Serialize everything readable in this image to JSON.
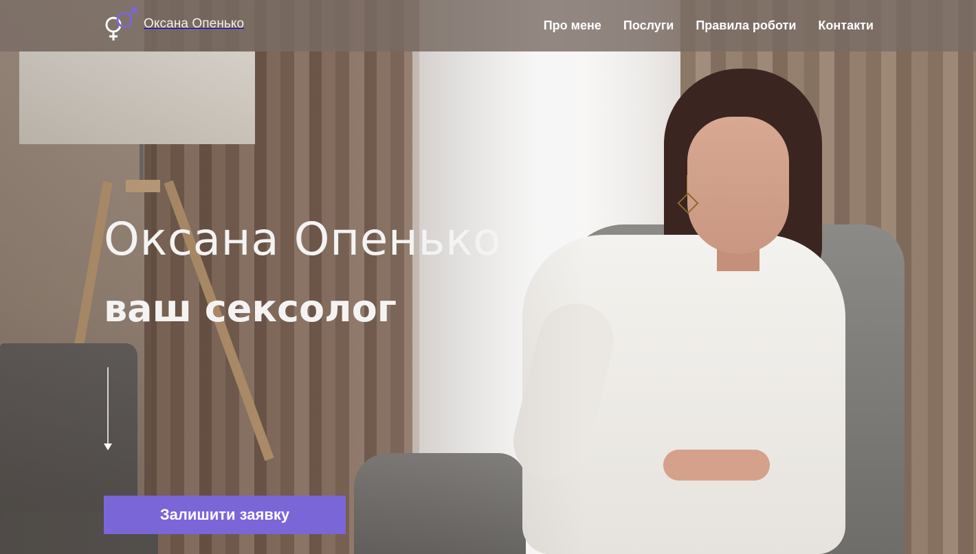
{
  "header": {
    "logo_text": "Оксана Опенько",
    "logo_icon": "gender-symbols-icon",
    "nav": [
      {
        "label": "Про мене"
      },
      {
        "label": "Послуги"
      },
      {
        "label": "Правила роботи"
      },
      {
        "label": "Контакти"
      }
    ]
  },
  "hero": {
    "title": "Оксана Опенько",
    "subtitle": "ваш сексолог",
    "scroll_icon": "arrow-down-icon",
    "cta_label": "Залишити заявку"
  },
  "colors": {
    "accent": "#7b66d8",
    "nav_bg": "#786c64",
    "text_light": "#f4f3f2"
  }
}
